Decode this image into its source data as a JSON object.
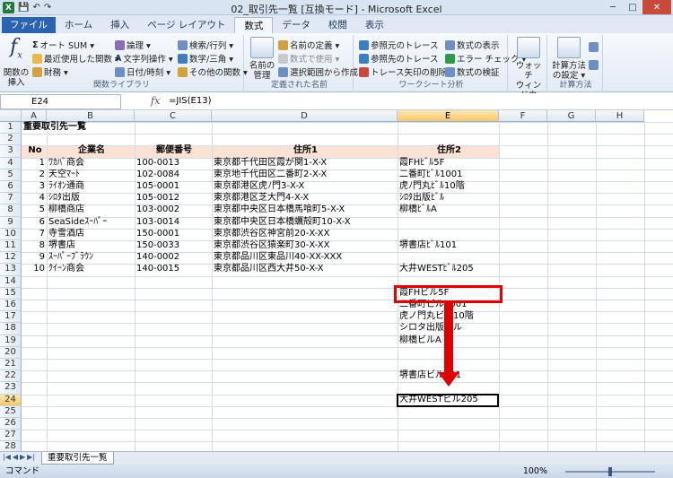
{
  "window": {
    "title": "02_取引先一覧 [互換モード] - Microsoft Excel",
    "logo": "X",
    "min": "─",
    "max": "□",
    "close": "✕"
  },
  "quick_access": [
    "💾",
    "↶",
    "↷"
  ],
  "tabs": [
    "ファイル",
    "ホーム",
    "挿入",
    "ページ レイアウト",
    "数式",
    "データ",
    "校閲",
    "表示"
  ],
  "ribbon": {
    "insert_function": "関数の\n挿入",
    "g1": {
      "autosum": "オート SUM ▾",
      "recent": "最近使用した関数 ▾",
      "finance": "財務 ▾",
      "logical": "論理 ▾",
      "text": "文字列操作 ▾",
      "datetime": "日付/時刻 ▾",
      "lookup": "検索/行列 ▾",
      "math": "数学/三角 ▾",
      "other": "その他の関数 ▾",
      "label": "関数ライブラリ"
    },
    "g2": {
      "name_mgr": "名前の\n管理",
      "define": "名前の定義 ▾",
      "use": "数式で使用 ▾",
      "create": "選択範囲から作成",
      "label": "定義された名前"
    },
    "g3": {
      "trace_prec": "参照元のトレース",
      "trace_dep": "参照先のトレース",
      "remove": "トレース矢印の削除 ▾",
      "show": "数式の表示",
      "errcheck": "エラー チェック ▾",
      "eval": "数式の検証",
      "label": "ワークシート分析"
    },
    "watch": "ウォッチ\nウィンドウ",
    "g4": {
      "calc_opt": "計算方法\nの設定 ▾",
      "label": "計算方法"
    }
  },
  "formula_bar": {
    "name_box": "E24",
    "fx": "fx",
    "formula": "=JIS(E13)"
  },
  "columns": [
    "A",
    "B",
    "C",
    "D",
    "E",
    "F",
    "G",
    "H"
  ],
  "rows": [
    "1",
    "2",
    "3",
    "4",
    "5",
    "6",
    "7",
    "8",
    "9",
    "10",
    "11",
    "12",
    "13",
    "14",
    "15",
    "16",
    "17",
    "18",
    "19",
    "20",
    "21",
    "22",
    "23",
    "24",
    "25",
    "26",
    "27",
    "28",
    "29"
  ],
  "sheet": {
    "title": "重要取引先一覧",
    "headers": {
      "no": "No",
      "company": "企業名",
      "zip": "郵便番号",
      "addr1": "住所1",
      "addr2": "住所2"
    },
    "records": [
      {
        "no": "1",
        "company": "ﾜｶﾊﾞ商会",
        "zip": "100-0013",
        "addr1": "東京都千代田区霞が関1-X-X",
        "addr2": "霞FHﾋﾞﾙ5F"
      },
      {
        "no": "2",
        "company": "天空ﾏｰﾄ",
        "zip": "102-0084",
        "addr1": "東京地千代田区二番町2-X-X",
        "addr2": "二番町ﾋﾞﾙ1001"
      },
      {
        "no": "3",
        "company": "ﾗｲｵﾝ通商",
        "zip": "105-0001",
        "addr1": "東京都港区虎ﾉ門3-X-X",
        "addr2": "虎ﾉ門丸ﾋﾞﾙ10階"
      },
      {
        "no": "4",
        "company": "ｼﾛﾀ出版",
        "zip": "105-0012",
        "addr1": "東京都港区芝大門4-X-X",
        "addr2": "ｼﾛﾀ出版ﾋﾞﾙ"
      },
      {
        "no": "5",
        "company": "柳橋商店",
        "zip": "103-0002",
        "addr1": "東京都中央区日本橋馬喰町5-X-X",
        "addr2": "柳橋ﾋﾞﾙA"
      },
      {
        "no": "6",
        "company": "SeaSideｽｰﾊﾟｰ",
        "zip": "103-0014",
        "addr1": "東京都中央区日本橋蠣殻町10-X-X",
        "addr2": ""
      },
      {
        "no": "7",
        "company": "寺雪酒店",
        "zip": "150-0001",
        "addr1": "東京都渋谷区神宮前20-X-XX",
        "addr2": ""
      },
      {
        "no": "8",
        "company": "堺書店",
        "zip": "150-0033",
        "addr1": "東京都渋谷区猿楽町30-X-XX",
        "addr2": "堺書店ﾋﾞﾙ101"
      },
      {
        "no": "9",
        "company": "ｽｰﾊﾟｰﾌﾞﾗｳﾝ",
        "zip": "140-0002",
        "addr1": "東京都品川区東品川40-XX-XXX",
        "addr2": ""
      },
      {
        "no": "10",
        "company": "ｸｲｰﾝ商会",
        "zip": "140-0015",
        "addr1": "東京都品川区西大井50-X-X",
        "addr2": "大井WESTﾋﾞﾙ205"
      }
    ],
    "converted": [
      "霞FHビル5F",
      "二番町ビル1001",
      "虎ノ門丸ビル10階",
      "シロタ出版ビル",
      "柳橋ビルA",
      "",
      "",
      "堺書店ビル101",
      "",
      "大井WESTビル205"
    ]
  },
  "sheet_tab": "重要取引先一覧",
  "sheet_nav": [
    "|◀",
    "◀",
    "▶",
    "▶|"
  ],
  "status": {
    "mode": "コマンド",
    "zoom": "100%"
  },
  "colors": {
    "header_fill": "#fbe2d5",
    "highlight": "#e00000",
    "accent": "#2a63b0"
  }
}
